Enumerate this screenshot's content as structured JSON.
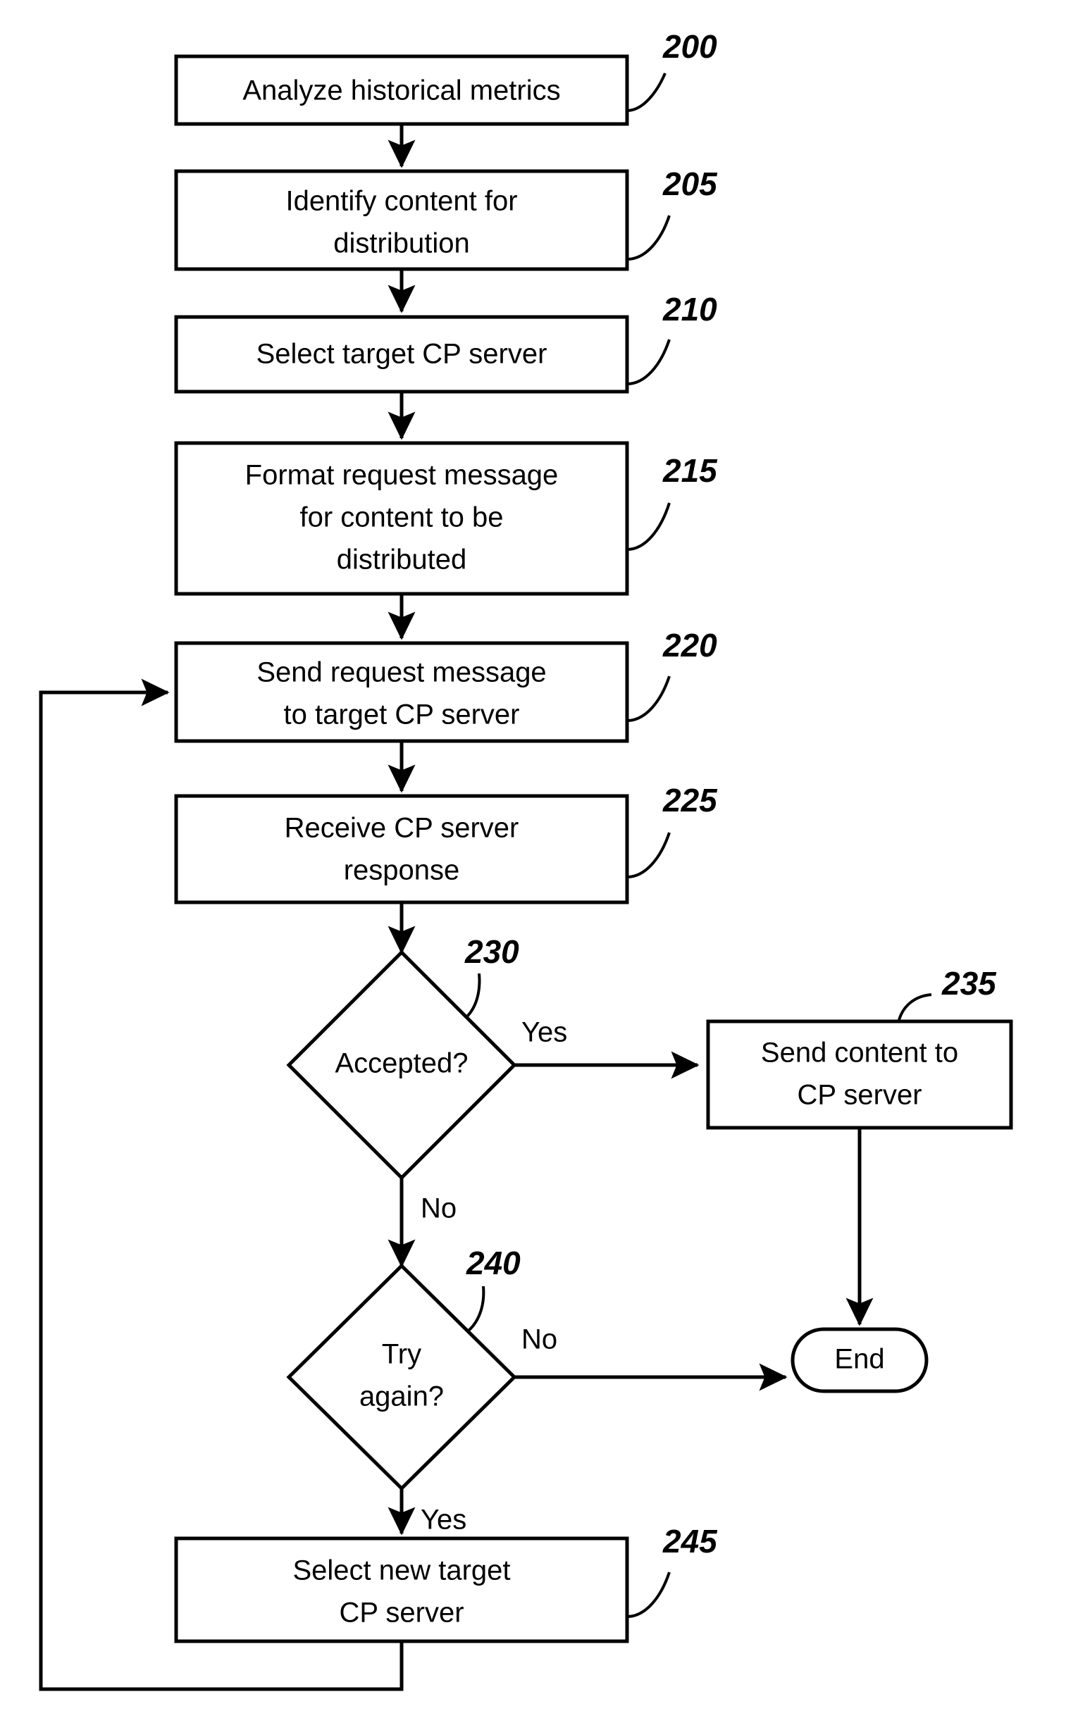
{
  "figure": {
    "type": "patent-flowchart",
    "background_color": "#ffffff",
    "line_color": "#000000"
  },
  "nodes": {
    "n200": {
      "ref": "200",
      "shape": "process",
      "lines": [
        "Analyze historical metrics"
      ]
    },
    "n205": {
      "ref": "205",
      "shape": "process",
      "lines": [
        "Identify content for",
        "distribution"
      ]
    },
    "n210": {
      "ref": "210",
      "shape": "process",
      "lines": [
        "Select target CP server"
      ]
    },
    "n215": {
      "ref": "215",
      "shape": "process",
      "lines": [
        "Format request message",
        "for content to be",
        "distributed"
      ]
    },
    "n220": {
      "ref": "220",
      "shape": "process",
      "lines": [
        "Send request message",
        "to target CP server"
      ]
    },
    "n225": {
      "ref": "225",
      "shape": "process",
      "lines": [
        "Receive CP server",
        "response"
      ]
    },
    "n230": {
      "ref": "230",
      "shape": "decision",
      "lines": [
        "Accepted?"
      ]
    },
    "n235": {
      "ref": "235",
      "shape": "process",
      "lines": [
        "Send content to",
        "CP server"
      ]
    },
    "n240": {
      "ref": "240",
      "shape": "decision",
      "lines": [
        "Try",
        "again?"
      ]
    },
    "n245": {
      "ref": "245",
      "shape": "process",
      "lines": [
        "Select new target",
        "CP server"
      ]
    },
    "nend": {
      "ref": "",
      "shape": "terminator",
      "lines": [
        "End"
      ]
    }
  },
  "edge_labels": {
    "accepted_yes": "Yes",
    "accepted_no": "No",
    "tryagain_no": "No",
    "tryagain_yes": "Yes"
  }
}
